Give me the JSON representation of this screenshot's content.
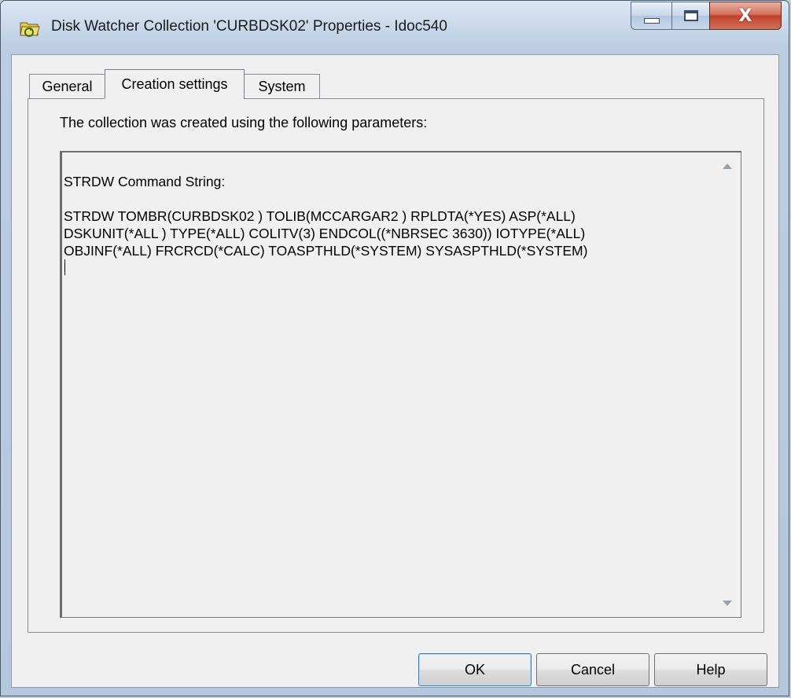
{
  "window": {
    "title": "Disk Watcher Collection 'CURBDSK02' Properties - Idoc540"
  },
  "tabs": [
    {
      "label": "General"
    },
    {
      "label": "Creation settings"
    },
    {
      "label": "System"
    }
  ],
  "panel": {
    "intro": "The collection was created using the following parameters:",
    "command_header": "STRDW Command String:",
    "command_lines": [
      "STRDW TOMBR(CURBDSK02 ) TOLIB(MCCARGAR2 ) RPLDTA(*YES) ASP(*ALL)",
      "DSKUNIT(*ALL ) TYPE(*ALL) COLITV(3) ENDCOL((*NBRSEC 3630)) IOTYPE(*ALL)",
      "OBJINF(*ALL) FRCRCD(*CALC) TOASPTHLD(*SYSTEM) SYSASPTHLD(*SYSTEM)"
    ]
  },
  "buttons": {
    "ok": "OK",
    "cancel": "Cancel",
    "help": "Help"
  },
  "icons": {
    "app": "folder-icon",
    "minimize": "minimize-icon",
    "maximize": "maximize-icon",
    "close": "close-icon",
    "scroll_up": "scroll-up-arrow-icon",
    "scroll_down": "scroll-down-arrow-icon"
  }
}
